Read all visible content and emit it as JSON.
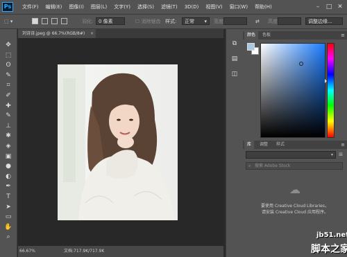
{
  "app": {
    "logo": "Ps"
  },
  "menu": [
    "文件(F)",
    "编辑(E)",
    "图像(I)",
    "图层(L)",
    "文字(Y)",
    "选择(S)",
    "滤镜(T)",
    "3D(D)",
    "视图(V)",
    "窗口(W)",
    "帮助(H)"
  ],
  "window_controls": {
    "minimize": "–",
    "maximize": "□",
    "close": "✕"
  },
  "options": {
    "feather_label": "羽化:",
    "feather_value": "0 像素",
    "antialias_label": "消除锯齿",
    "style_label": "样式:",
    "style_value": "正常",
    "width_label": "宽度:",
    "height_label": "高度:",
    "refine_edge": "调整边缘..."
  },
  "document": {
    "tab_title": "刘诗诗.jpeg @ 66.7%(RGB/8#)",
    "close": "×",
    "zoom": "66.67%",
    "doc_info": "文档:717.9K/717.9K"
  },
  "tools": [
    "move-tool-icon",
    "marquee-tool-icon",
    "lasso-tool-icon",
    "quick-select-tool-icon",
    "crop-tool-icon",
    "eyedropper-tool-icon",
    "healing-brush-tool-icon",
    "brush-tool-icon",
    "clone-stamp-tool-icon",
    "history-brush-tool-icon",
    "eraser-tool-icon",
    "gradient-tool-icon",
    "blur-tool-icon",
    "dodge-tool-icon",
    "pen-tool-icon",
    "type-tool-icon",
    "path-select-tool-icon",
    "shape-tool-icon",
    "hand-tool-icon",
    "zoom-tool-icon"
  ],
  "tool_glyphs": [
    "✥",
    "⬚",
    "ʘ",
    "✎",
    "⌗",
    "✐",
    "✚",
    "✎",
    "⊥",
    "✱",
    "◈",
    "▣",
    "●",
    "◐",
    "✒",
    "T",
    "➤",
    "▭",
    "✋",
    "⌕"
  ],
  "color_panel": {
    "tabs": [
      "颜色",
      "色板"
    ],
    "menu": "≡"
  },
  "library_panel": {
    "tabs": [
      "库",
      "调整",
      "样式"
    ],
    "menu": "≡",
    "search_placeholder": "搜索 Adobe Stock",
    "message_line1": "要使用 Creative Cloud Libraries，",
    "message_line2": "请安装 Creative Cloud 应用程序。"
  },
  "watermark": {
    "line1": "jb51.net",
    "line2": "脚本之家"
  }
}
